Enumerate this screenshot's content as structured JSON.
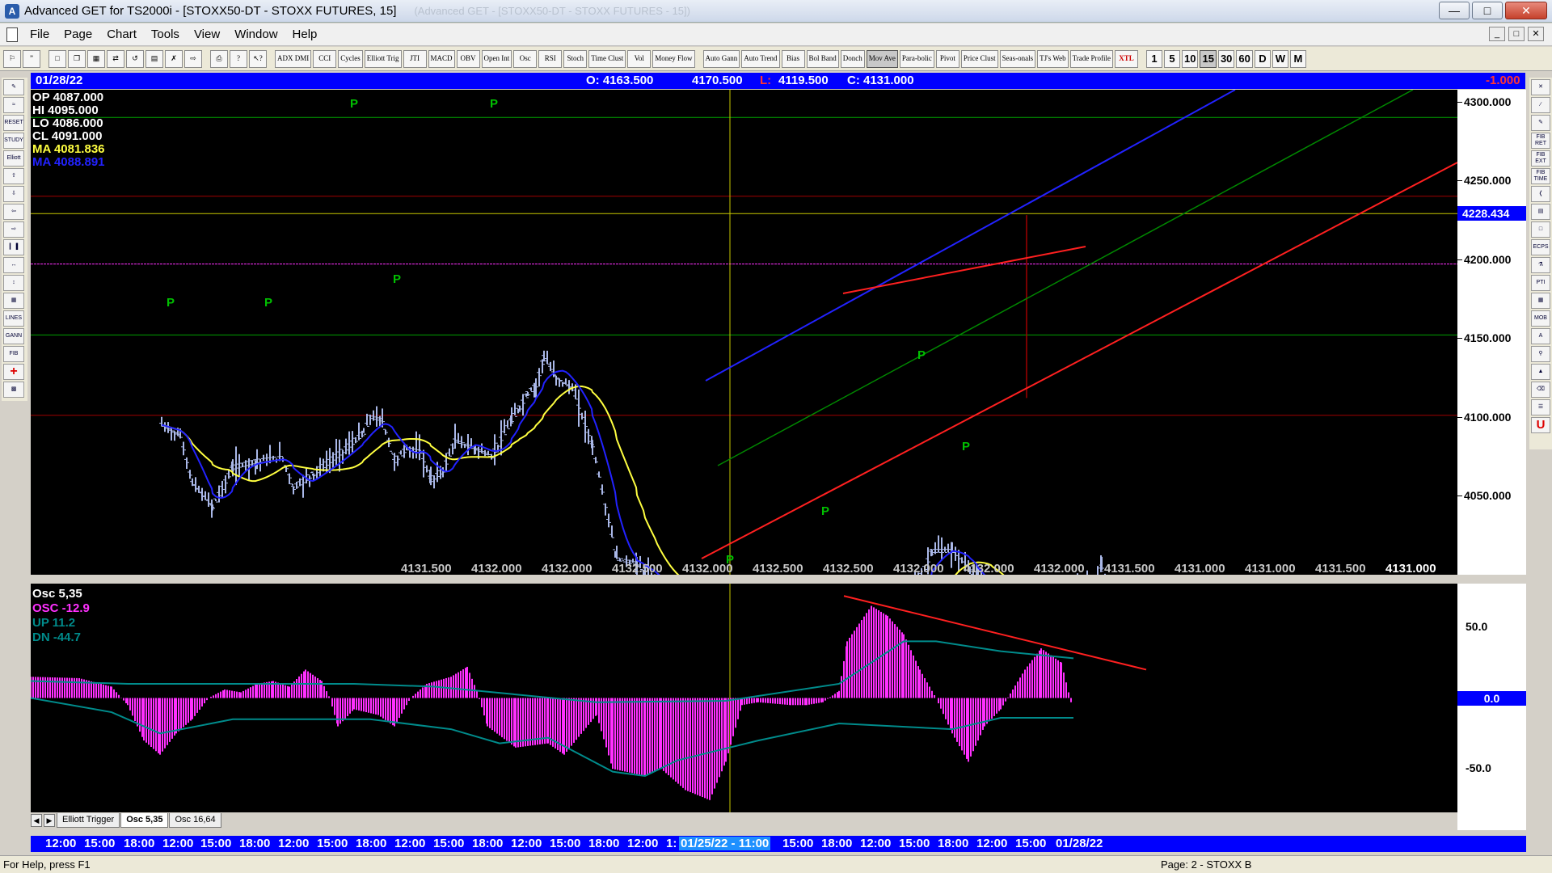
{
  "window": {
    "title": "Advanced GET for TS2000i - [STOXX50-DT - STOXX FUTURES, 15]",
    "ghost_title": "(Advanced GET - [STOXX50-DT - STOXX FUTURES - 15])"
  },
  "menu": [
    "File",
    "Page",
    "Chart",
    "Tools",
    "View",
    "Window",
    "Help"
  ],
  "toolbar": {
    "studies": [
      "ADX DMI",
      "CCI",
      "Cycles",
      "Elliott Trig",
      "JTI",
      "MACD",
      "OBV",
      "Open Int",
      "Osc",
      "RSI",
      "Stoch",
      "Time Clust",
      "Vol",
      "Money Flow"
    ],
    "studies2": [
      "Auto Gann",
      "Auto Trend",
      "Bias",
      "Bol Band",
      "Donch",
      "Mov Ave",
      "Para-bolic",
      "Pivot",
      "Price Clust",
      "Seas-onals",
      "TJ's Web",
      "Trade Profile",
      "XTL"
    ],
    "intervals": [
      "1",
      "5",
      "10",
      "15",
      "30",
      "60",
      "D",
      "W",
      "M"
    ]
  },
  "infobar": {
    "date": "01/28/22",
    "open": "O: 4163.500",
    "high": "4170.500",
    "low_label": "L:",
    "low": "4119.500",
    "close": "C: 4131.000",
    "change": "-1.000"
  },
  "legend": {
    "op": "OP  4087.000",
    "hi": "HI   4095.000",
    "lo": "LO  4086.000",
    "cl": "CL  4091.000",
    "ma1": "MA  4081.836",
    "ma2": "MA  4088.891"
  },
  "price_axis": {
    "ticks": [
      "4300.000",
      "4250.000",
      "4200.000",
      "4150.000",
      "4100.000",
      "4050.000"
    ],
    "marker": "4228.434"
  },
  "bottom_values": [
    "4131.500",
    "4132.000",
    "4132.000",
    "4132.500",
    "4132.000",
    "4132.500",
    "4132.500",
    "4132.000",
    "4132.000",
    "4132.000",
    "4131.500",
    "4131.000",
    "4131.000",
    "4131.500",
    "4131.000"
  ],
  "oscillator": {
    "title": "Osc 5,35",
    "osc": "OSC -12.9",
    "up": "UP   11.2",
    "dn": "DN   -44.7",
    "ticks": [
      "50.0",
      "0.0",
      "-50.0"
    ]
  },
  "tabs": [
    "Elliott Trigger",
    "Osc 5,35",
    "Osc 16,64"
  ],
  "time_axis": {
    "labels": [
      "12:00",
      "15:00",
      "18:00",
      "12:00",
      "15:00",
      "18:00",
      "12:00",
      "15:00",
      "18:00",
      "12:00",
      "15:00",
      "18:00",
      "12:00",
      "15:00",
      "18:00",
      "12:00",
      "1:"
    ],
    "highlight": "01/25/22 - 11:00",
    "labels2": [
      "15:00",
      "18:00",
      "12:00",
      "15:00",
      "18:00",
      "12:00",
      "15:00",
      "01/28/22"
    ]
  },
  "status": {
    "help": "For Help, press F1",
    "page": "Page: 2 - STOXX B"
  },
  "chart_data": {
    "type": "candlestick",
    "ylim": [
      4005,
      4305
    ],
    "series_colors": {
      "bars": "#aab8e8",
      "ma_fast": "#ffff40",
      "ma_slow": "#2222ff",
      "pivots": "#00c000"
    },
    "pivot_label": "P",
    "osc_ylim": [
      -75,
      75
    ]
  }
}
